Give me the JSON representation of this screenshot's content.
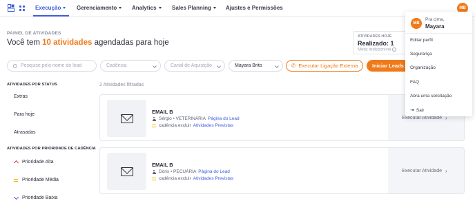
{
  "nav": {
    "items": [
      {
        "label": "Execução"
      },
      {
        "label": "Gerenciamento"
      },
      {
        "label": "Analytics"
      },
      {
        "label": "Sales Planning"
      },
      {
        "label": "Ajustes e Permissões"
      }
    ],
    "avatar_initials": "MB"
  },
  "header": {
    "section_tag": "PAINEL DE ATIVIDADES",
    "title_prefix": "Você tem ",
    "title_highlight": "10 atividades",
    "title_suffix": " agendadas para hoje"
  },
  "stat_card": {
    "label": "ATIVIDADES HOJE",
    "value": "Realizado: 1",
    "meta": "Meta: indisponível"
  },
  "filters": {
    "search_placeholder": "Pesquise pelo nome do lead",
    "cadence_placeholder": "Cadência",
    "channel_placeholder": "Canal de Aquisição",
    "owner_value": "Mayara Brito",
    "call_button": "Executar Ligação Externa",
    "start_button": "Iniciar Leads"
  },
  "sidebar": {
    "status_heading": "ATIVIDADES POR STATUS",
    "status_items": [
      {
        "label": "Extras"
      },
      {
        "label": "Para hoje"
      },
      {
        "label": "Atrasadas"
      }
    ],
    "priority_heading": "ATIVIDADES POR PRIORIDADE DE CADÊNCIA",
    "priority_items": [
      {
        "label": "Prioridade Alta",
        "icon": "priority-high-icon",
        "color": "#e03131"
      },
      {
        "label": "Prioridade Média",
        "icon": "priority-medium-icon",
        "color": "#f2b705"
      },
      {
        "label": "Prioridade Baixa",
        "icon": "priority-low-icon",
        "color": "#3b5bdb"
      }
    ]
  },
  "list": {
    "filtered_count": "2 Atividades filtradas",
    "cards": [
      {
        "title": "EMAIL B",
        "person": "Sérgio • VETERINÁRIA",
        "lead_link": "Página do Lead",
        "cadence": "cadência excluir",
        "planned_link": "Atividades Previstas",
        "action": "Executar Atividade"
      },
      {
        "title": "EMAIL B",
        "person": "Dóris • PECUÁRIA",
        "lead_link": "Página do Lead",
        "cadence": "cadência excluir",
        "planned_link": "Atividades Previstas",
        "action": "Executar Atividade"
      }
    ]
  },
  "profile_menu": {
    "greeting": "Pra cima,",
    "name": "Mayara",
    "items": [
      {
        "label": "Editar perfil"
      },
      {
        "label": "Segurança"
      },
      {
        "label": "Organização"
      },
      {
        "label": "FAQ"
      },
      {
        "label": "Abra uma solicitação"
      },
      {
        "label": "Sair"
      }
    ]
  },
  "colors": {
    "accent_orange": "#f07a1a",
    "accent_blue": "#3b5bdb"
  }
}
